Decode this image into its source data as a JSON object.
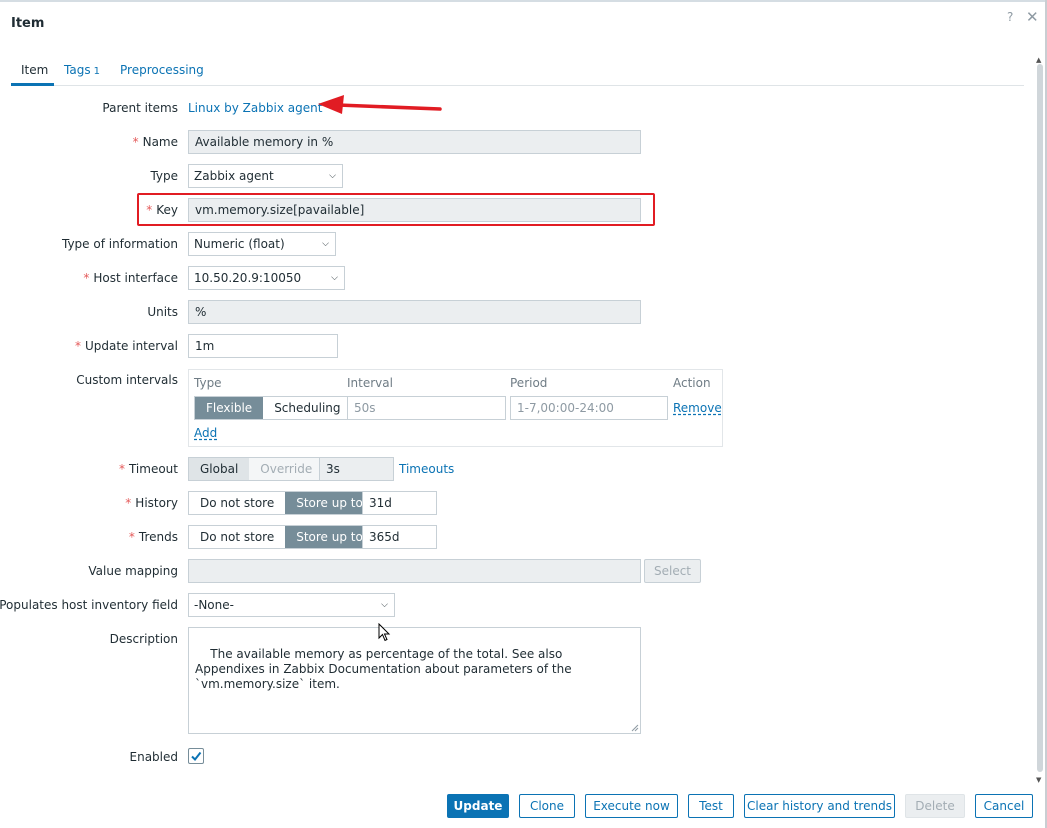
{
  "dialog": {
    "title": "Item",
    "help_glyph": "?",
    "close_glyph": "✕"
  },
  "tabs": [
    {
      "label": "Item"
    },
    {
      "label": "Tags",
      "count": "1"
    },
    {
      "label": "Preprocessing"
    }
  ],
  "form": {
    "parent_items": {
      "label": "Parent items",
      "value": "Linux by Zabbix agent"
    },
    "name": {
      "label": "Name",
      "value": "Available memory in %"
    },
    "type": {
      "label": "Type",
      "value": "Zabbix agent"
    },
    "key": {
      "label": "Key",
      "value": "vm.memory.size[pavailable]"
    },
    "type_of_information": {
      "label": "Type of information",
      "value": "Numeric (float)"
    },
    "host_interface": {
      "label": "Host interface",
      "value": "10.50.20.9:10050"
    },
    "units": {
      "label": "Units",
      "value": "%"
    },
    "update_interval": {
      "label": "Update interval",
      "value": "1m"
    },
    "custom_intervals": {
      "label": "Custom intervals",
      "headers": {
        "type": "Type",
        "interval": "Interval",
        "period": "Period",
        "action": "Action"
      },
      "type_options": [
        "Flexible",
        "Scheduling"
      ],
      "selected_type": "Flexible",
      "interval_placeholder": "50s",
      "period_placeholder": "1-7,00:00-24:00",
      "remove_label": "Remove",
      "add_label": "Add"
    },
    "timeout": {
      "label": "Timeout",
      "options": [
        "Global",
        "Override"
      ],
      "selected": "Global",
      "value": "3s",
      "link": "Timeouts"
    },
    "history": {
      "label": "History",
      "options": [
        "Do not store",
        "Store up to"
      ],
      "selected": "Store up to",
      "value": "31d"
    },
    "trends": {
      "label": "Trends",
      "options": [
        "Do not store",
        "Store up to"
      ],
      "selected": "Store up to",
      "value": "365d"
    },
    "value_mapping": {
      "label": "Value mapping",
      "value": "",
      "select_label": "Select"
    },
    "inventory": {
      "label": "Populates host inventory field",
      "value": "-None-"
    },
    "description": {
      "label": "Description",
      "value": "The available memory as percentage of the total. See also Appendixes in Zabbix Documentation about parameters of the `vm.memory.size` item."
    },
    "enabled": {
      "label": "Enabled",
      "checked": true
    }
  },
  "buttons": {
    "update": "Update",
    "clone": "Clone",
    "execute_now": "Execute now",
    "test": "Test",
    "clear": "Clear history and trends",
    "delete": "Delete",
    "cancel": "Cancel"
  },
  "required_mark": "*",
  "colors": {
    "link": "#0b73b4",
    "annotation_red": "#e11c23",
    "segment_active": "#768d99"
  }
}
